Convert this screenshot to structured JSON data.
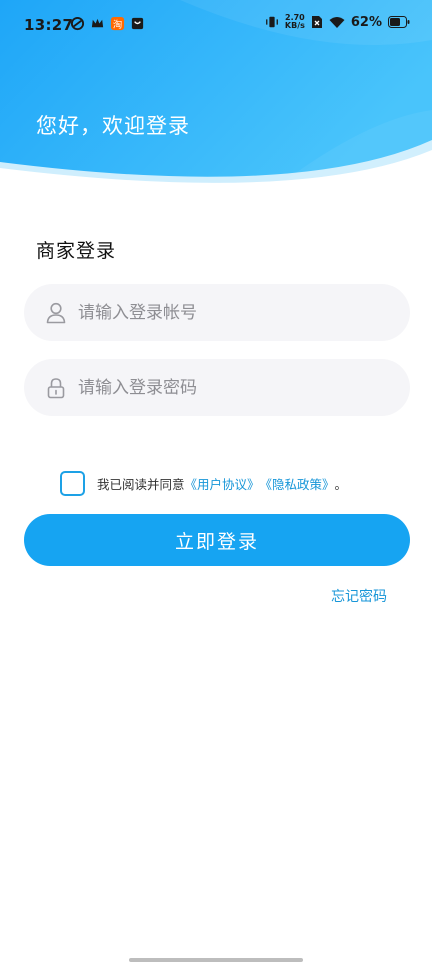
{
  "status_bar": {
    "time": "13:27",
    "net_speed_value": "2.70",
    "net_speed_unit": "KB/s",
    "battery_percent": "62%"
  },
  "header": {
    "welcome_text": "您好，欢迎登录"
  },
  "login": {
    "section_title": "商家登录",
    "account_placeholder": "请输入登录帐号",
    "password_placeholder": "请输入登录密码",
    "agreement_prefix": "我已阅读并同意",
    "user_agreement_link": "《用户协议》",
    "privacy_policy_link": "《隐私政策》",
    "agreement_suffix": "。",
    "agreement_checked": false,
    "login_button": "立即登录",
    "forgot_password": "忘记密码"
  },
  "colors": {
    "header_gradient_start": "#1ea6f8",
    "header_gradient_end": "#49c4fb",
    "primary_button": "#16a4f2",
    "link": "#1796d8",
    "field_background": "#f5f5f8"
  }
}
